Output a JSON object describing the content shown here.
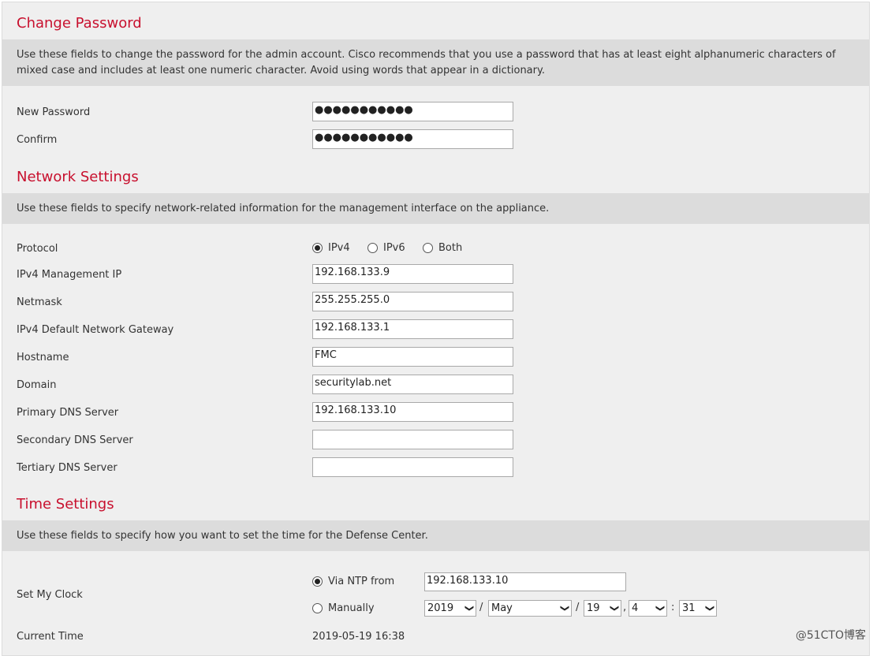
{
  "change_password": {
    "title": "Change Password",
    "description": "Use these fields to change the password for the admin account. Cisco recommends that you use a password that has at least eight alphanumeric characters of mixed case and includes at least one numeric character. Avoid using words that appear in a dictionary.",
    "new_password_label": "New Password",
    "new_password_value": "●●●●●●●●●●●",
    "confirm_label": "Confirm",
    "confirm_value": "●●●●●●●●●●●"
  },
  "network_settings": {
    "title": "Network Settings",
    "description": "Use these fields to specify network-related information for the management interface on the appliance.",
    "protocol_label": "Protocol",
    "protocol_options": [
      "IPv4",
      "IPv6",
      "Both"
    ],
    "protocol_selected": "IPv4",
    "fields": [
      {
        "label": "IPv4 Management IP",
        "value": "192.168.133.9"
      },
      {
        "label": "Netmask",
        "value": "255.255.255.0"
      },
      {
        "label": "IPv4 Default Network Gateway",
        "value": "192.168.133.1"
      },
      {
        "label": "Hostname",
        "value": "FMC"
      },
      {
        "label": "Domain",
        "value": "securitylab.net"
      },
      {
        "label": "Primary DNS Server",
        "value": "192.168.133.10"
      },
      {
        "label": "Secondary DNS Server",
        "value": ""
      },
      {
        "label": "Tertiary DNS Server",
        "value": ""
      }
    ]
  },
  "time_settings": {
    "title": "Time Settings",
    "description": "Use these fields to specify how you want to set the time for the Defense Center.",
    "set_clock_label": "Set My Clock",
    "via_ntp_label": "Via NTP from",
    "ntp_server_value": "192.168.133.10",
    "manually_label": "Manually",
    "selected_mode": "Via NTP from",
    "year": "2019",
    "month": "May",
    "day": "19",
    "hour": "4",
    "minute": "31",
    "date_sep": "/",
    "comma_sep": ",",
    "time_sep": ":",
    "current_time_label": "Current Time",
    "current_time_value": "2019-05-19 16:38"
  },
  "watermark": "@51CTO博客",
  "colors": {
    "section_title": "#c8102e",
    "panel_bg": "#efefef",
    "desc_band_bg": "#dcdcdc"
  }
}
